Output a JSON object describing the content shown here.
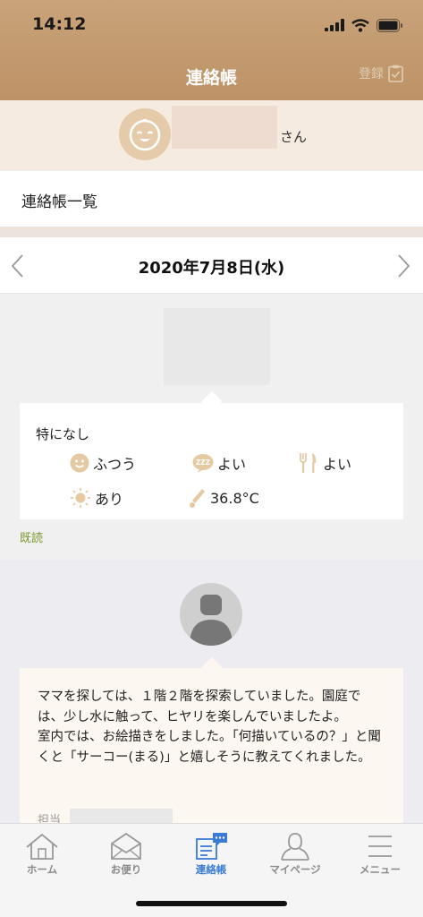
{
  "status_bar": {
    "time": "14:12"
  },
  "header": {
    "title": "連絡帳",
    "register_label": "登録"
  },
  "child": {
    "suffix": "さん"
  },
  "list_link": {
    "label": "連絡帳一覧"
  },
  "date_nav": {
    "date": "2020年7月8日(水)"
  },
  "home_report": {
    "note": "特になし",
    "mood": "ふつう",
    "sleep": "よい",
    "meal": "よい",
    "bowel": "あり",
    "temperature": "36.8°C",
    "read_status": "既読"
  },
  "staff_report": {
    "message": "ママを探しては、１階２階を探索していました。園庭では、少し水に触って、ヒヤリを楽しんでいましたよ。\n室内では、お絵描きをしました。「何描いているの？」と聞くと「サーコー(まる)」と嬉しそうに教えてくれました。",
    "staff_label": "担当"
  },
  "tabs": [
    {
      "label": "ホーム",
      "icon": "home-icon"
    },
    {
      "label": "お便り",
      "icon": "mail-icon"
    },
    {
      "label": "連絡帳",
      "icon": "notebook-chat-icon",
      "active": true
    },
    {
      "label": "マイページ",
      "icon": "person-icon"
    },
    {
      "label": "メニュー",
      "icon": "hamburger-menu-icon"
    }
  ],
  "colors": {
    "header": "#c09a6f",
    "accent_blue": "#3b7bd6",
    "read_green": "#7a9a2e",
    "icon_tan": "#e5c9a3"
  }
}
